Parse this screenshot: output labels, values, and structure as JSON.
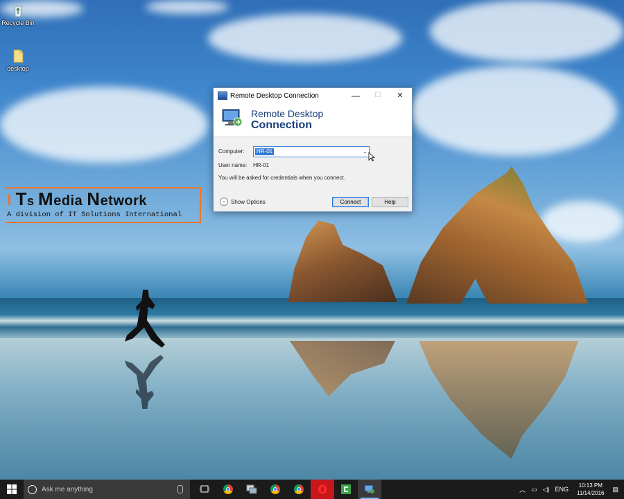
{
  "desktop": {
    "icons": [
      {
        "label": "Recycle Bin"
      },
      {
        "label": "desktop"
      }
    ]
  },
  "logo": {
    "title_parts": [
      "I",
      "T",
      "s ",
      "M",
      "edia ",
      "N",
      "etwork"
    ],
    "tagline": "A division of IT Solutions International"
  },
  "dialog": {
    "window_title": "Remote Desktop Connection",
    "banner_line1": "Remote Desktop",
    "banner_line2": "Connection",
    "computer_label": "Computer:",
    "computer_value": "HR-01",
    "username_label": "User name:",
    "username_value": "HR-01",
    "credentials_note": "You will be asked for credentials when you connect.",
    "show_options_label": "Show Options",
    "connect_label": "Connect",
    "help_label": "Help",
    "minimize_glyph": "—",
    "maximize_glyph": "☐",
    "close_glyph": "✕"
  },
  "taskbar": {
    "search_placeholder": "Ask me anything",
    "apps": [
      {
        "icon": "task-view-icon"
      },
      {
        "icon": "chrome-icon"
      },
      {
        "icon": "remote-admin-icon"
      },
      {
        "icon": "chrome-icon"
      },
      {
        "icon": "chrome-icon"
      },
      {
        "icon": "opera-icon"
      },
      {
        "icon": "camtasia-icon"
      },
      {
        "icon": "remote-desktop-icon",
        "active": true
      }
    ],
    "tray": {
      "language": "ENG",
      "time": "10:13 PM",
      "date": "11/14/2016"
    }
  }
}
